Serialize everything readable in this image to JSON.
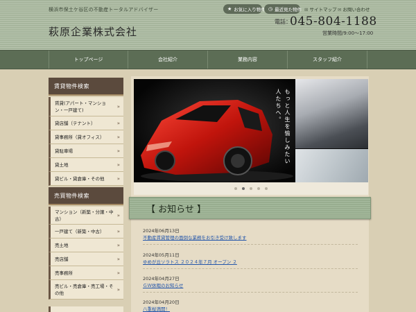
{
  "header": {
    "tagline": "横浜市保土ケ谷区の不動産トータルアドバイザー",
    "company": "萩原企業株式会社",
    "fav_label": "お気に入り物件",
    "recent_label": "最近見た物件",
    "sitemap_label": "サイトマップ",
    "contact_label": "お問い合わせ",
    "phone_label": "電話：",
    "phone": "045-804-1188",
    "hours": "営業時間/9:00～17:00"
  },
  "nav": {
    "items": [
      {
        "label": "トップページ"
      },
      {
        "label": "会社紹介"
      },
      {
        "label": "業務内容"
      },
      {
        "label": "スタッフ紹介"
      }
    ]
  },
  "sidebar": {
    "rental_title": "賃貸物件検索",
    "rental_items": [
      {
        "label": "賃貸(アパート・マンション・一戸建て)"
      },
      {
        "label": "貸店舗（テナント）"
      },
      {
        "label": "貸事務所（貸オフィス）"
      },
      {
        "label": "貸駐車場"
      },
      {
        "label": "貸土地"
      },
      {
        "label": "貸ビル・貸倉庫・その他"
      }
    ],
    "sale_title": "売買物件検索",
    "sale_items": [
      {
        "label": "マンション（新築・分譲・中古）"
      },
      {
        "label": "一戸建て（新築・中古）"
      },
      {
        "label": "売土地"
      },
      {
        "label": "売店舗"
      },
      {
        "label": "売事務所"
      },
      {
        "label": "売ビル・売倉庫・売工場・その他"
      }
    ]
  },
  "hero": {
    "copy": "もっと人生を愉しみたい人たちへ。",
    "slides_count": 5,
    "active_slide": 2
  },
  "news": {
    "title": "【 お知らせ 】",
    "items": [
      {
        "date": "2024年06月13日",
        "title": "不動産賃貸管理の面倒な業務をお引き受け致します"
      },
      {
        "date": "2024年05月11日",
        "title": "ゆめが丘ソラトス ２０２４年７月 オープン ２"
      },
      {
        "date": "2024年04月27日",
        "title": "ＧＷ休暇のお知らせ"
      },
      {
        "date": "2024年04月20日",
        "title": "八重桜満開！"
      }
    ]
  },
  "colors": {
    "header_bg": "#b7c4ae",
    "nav_bg": "#5c6d55",
    "sidebar_head": "#5b4a3d",
    "sidebar_item": "#efe7d3",
    "link": "#2255aa"
  }
}
